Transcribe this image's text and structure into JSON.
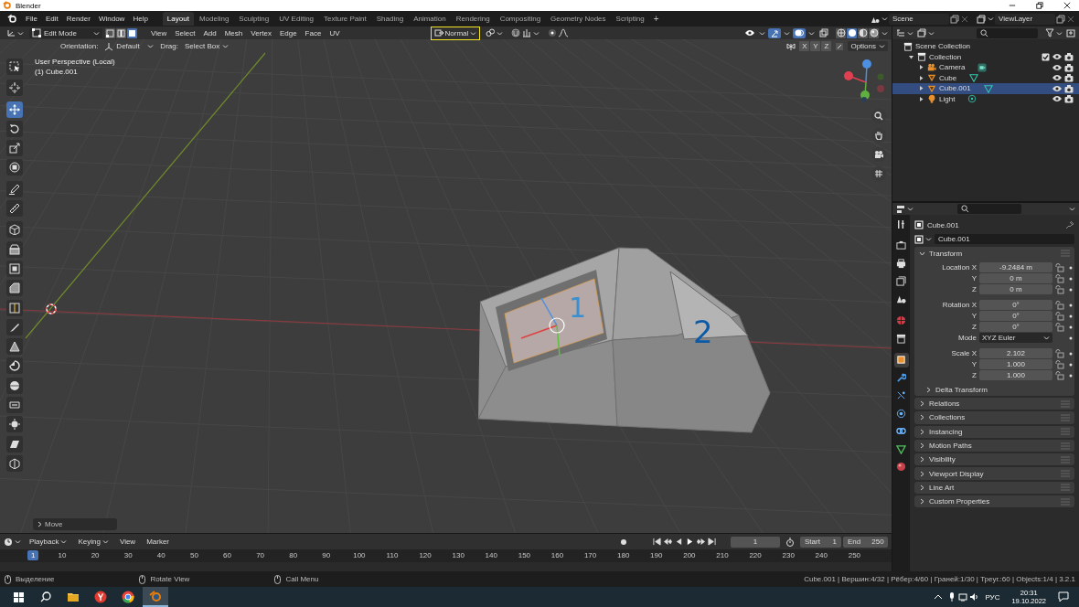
{
  "window": {
    "title": "Blender"
  },
  "menu": [
    "File",
    "Edit",
    "Render",
    "Window",
    "Help"
  ],
  "workspaces": [
    {
      "label": "Layout",
      "selected": true
    },
    {
      "label": "Modeling",
      "selected": false
    },
    {
      "label": "Sculpting",
      "selected": false
    },
    {
      "label": "UV Editing",
      "selected": false
    },
    {
      "label": "Texture Paint",
      "selected": false
    },
    {
      "label": "Shading",
      "selected": false
    },
    {
      "label": "Animation",
      "selected": false
    },
    {
      "label": "Rendering",
      "selected": false
    },
    {
      "label": "Compositing",
      "selected": false
    },
    {
      "label": "Geometry Nodes",
      "selected": false
    },
    {
      "label": "Scripting",
      "selected": false
    }
  ],
  "add_workspace": "+",
  "scene": {
    "scene": "Scene",
    "view_layer": "ViewLayer"
  },
  "viewport_header": {
    "mode": "Edit Mode",
    "select_modes": [
      {
        "kind": "vertex",
        "selected": false
      },
      {
        "kind": "edge",
        "selected": false
      },
      {
        "kind": "face",
        "selected": true
      }
    ],
    "menus": [
      "View",
      "Select",
      "Add",
      "Mesh",
      "Vertex",
      "Edge",
      "Face",
      "UV"
    ],
    "pivot": {
      "label": "Normal",
      "highlighted": true
    },
    "toggles": [
      {
        "kind": "visibility",
        "on": false
      },
      {
        "kind": "gizmo",
        "on": true
      },
      {
        "kind": "overlay",
        "on": true
      },
      {
        "kind": "xray",
        "on": false
      }
    ],
    "shading": [
      {
        "kind": "wireframe",
        "selected": false
      },
      {
        "kind": "solid",
        "selected": true
      },
      {
        "kind": "material",
        "selected": false
      },
      {
        "kind": "rendered",
        "selected": false
      }
    ]
  },
  "tool_settings": {
    "orientation_label": "Orientation:",
    "orientation": "Default",
    "drag_label": "Drag:",
    "drag": "Select Box",
    "mirror_axes": [
      {
        "label": "X",
        "on": false
      },
      {
        "label": "Y",
        "on": false
      },
      {
        "label": "Z",
        "on": false
      }
    ],
    "options": "Options"
  },
  "toolbar": [
    {
      "kind": "select",
      "selected": false
    },
    {
      "kind": "cursor",
      "selected": false
    },
    {
      "kind": "move",
      "selected": true
    },
    {
      "kind": "rotate",
      "selected": false
    },
    {
      "kind": "scale",
      "selected": false
    },
    {
      "kind": "transform",
      "selected": false
    },
    {
      "kind": "annotate",
      "selected": false
    },
    {
      "kind": "measure",
      "selected": false
    },
    {
      "kind": "add-cube",
      "selected": false
    },
    {
      "kind": "extrude",
      "selected": false
    },
    {
      "kind": "inset",
      "selected": false
    },
    {
      "kind": "bevel",
      "selected": false
    },
    {
      "kind": "loop-cut",
      "selected": false
    },
    {
      "kind": "knife",
      "selected": false
    },
    {
      "kind": "poly-build",
      "selected": false
    },
    {
      "kind": "spin",
      "selected": false
    },
    {
      "kind": "smooth",
      "selected": false
    },
    {
      "kind": "edge-slide",
      "selected": false
    },
    {
      "kind": "shrink",
      "selected": false
    },
    {
      "kind": "shear",
      "selected": false
    },
    {
      "kind": "rip",
      "selected": false
    }
  ],
  "viewport": {
    "view_name": "User Perspective (Local)",
    "object_name": "(1) Cube.001",
    "face_labels": [
      "1",
      "2"
    ],
    "last_operator": "Move"
  },
  "outliner": {
    "root": "Scene Collection",
    "items": [
      {
        "label": "Collection",
        "kind": "collection",
        "checked": true,
        "expanded": true,
        "selected": false,
        "children": [
          {
            "label": "Camera",
            "kind": "camera",
            "expanded": false,
            "selected": false
          },
          {
            "label": "Cube",
            "kind": "mesh",
            "expanded": false,
            "selected": false
          },
          {
            "label": "Cube.001",
            "kind": "mesh",
            "expanded": false,
            "selected": true
          },
          {
            "label": "Light",
            "kind": "light",
            "expanded": false,
            "selected": false
          }
        ]
      }
    ]
  },
  "properties": {
    "tabs": [
      {
        "kind": "tool",
        "selected": false
      },
      {
        "kind": "render",
        "selected": false
      },
      {
        "kind": "output",
        "selected": false
      },
      {
        "kind": "view-layer",
        "selected": false
      },
      {
        "kind": "scene",
        "selected": false
      },
      {
        "kind": "world",
        "selected": false
      },
      {
        "kind": "collection",
        "selected": false
      },
      {
        "kind": "object",
        "selected": true
      },
      {
        "kind": "modifiers",
        "selected": false
      },
      {
        "kind": "particles",
        "selected": false
      },
      {
        "kind": "physics",
        "selected": false
      },
      {
        "kind": "constraints",
        "selected": false
      },
      {
        "kind": "data",
        "selected": false
      },
      {
        "kind": "material",
        "selected": false
      }
    ],
    "object_name": "Cube.001",
    "data_name": "Cube.001",
    "transform": {
      "title": "Transform",
      "expanded": true,
      "groups": [
        {
          "rows": [
            {
              "label": "Location X",
              "value": "-9.2484 m",
              "kind": "number"
            },
            {
              "label": "Y",
              "value": "0 m",
              "kind": "number"
            },
            {
              "label": "Z",
              "value": "0 m",
              "kind": "number"
            }
          ]
        },
        {
          "rows": [
            {
              "label": "Rotation X",
              "value": "0°",
              "kind": "number"
            },
            {
              "label": "Y",
              "value": "0°",
              "kind": "number"
            },
            {
              "label": "Z",
              "value": "0°",
              "kind": "number"
            },
            {
              "label": "Mode",
              "value": "XYZ Euler",
              "kind": "dropdown"
            }
          ]
        },
        {
          "rows": [
            {
              "label": "Scale X",
              "value": "2.102",
              "kind": "number"
            },
            {
              "label": "Y",
              "value": "1.000",
              "kind": "number"
            },
            {
              "label": "Z",
              "value": "1.000",
              "kind": "number"
            }
          ]
        }
      ],
      "subpanels": [
        {
          "title": "Delta Transform",
          "expanded": false
        }
      ]
    },
    "panels": [
      {
        "title": "Relations",
        "expanded": false
      },
      {
        "title": "Collections",
        "expanded": false
      },
      {
        "title": "Instancing",
        "expanded": false
      },
      {
        "title": "Motion Paths",
        "expanded": false
      },
      {
        "title": "Visibility",
        "expanded": false
      },
      {
        "title": "Viewport Display",
        "expanded": false
      },
      {
        "title": "Line Art",
        "expanded": false
      },
      {
        "title": "Custom Properties",
        "expanded": false
      }
    ]
  },
  "timeline": {
    "menus": [
      {
        "label": "Playback",
        "dropdown": true
      },
      {
        "label": "Keying",
        "dropdown": true
      },
      {
        "label": "View",
        "dropdown": false
      },
      {
        "label": "Marker",
        "dropdown": false
      }
    ],
    "current_frame": "1",
    "start_label": "Start",
    "start": "1",
    "end_label": "End",
    "end": "250",
    "frame_marker": "1",
    "ticks": [
      "10",
      "20",
      "30",
      "40",
      "50",
      "60",
      "70",
      "80",
      "90",
      "100",
      "110",
      "120",
      "130",
      "140",
      "150",
      "160",
      "170",
      "180",
      "190",
      "200",
      "210",
      "220",
      "230",
      "240",
      "250"
    ]
  },
  "status_bar": {
    "hints": [
      "Выделение",
      "Rotate View",
      "Call Menu"
    ],
    "stats": "Cube.001 | Вершин:4/32 | Рёбер:4/60 | Граней:1/30 | Треуг.:60 | Objects:1/4 | 3.2.1"
  },
  "taskbar": {
    "apps": [
      {
        "kind": "folder",
        "selected": false
      },
      {
        "kind": "browser-y",
        "selected": false
      },
      {
        "kind": "browser-c",
        "selected": false
      },
      {
        "kind": "blender",
        "selected": true
      }
    ],
    "language": "РУС",
    "time": "20:31",
    "date": "19.10.2022"
  }
}
